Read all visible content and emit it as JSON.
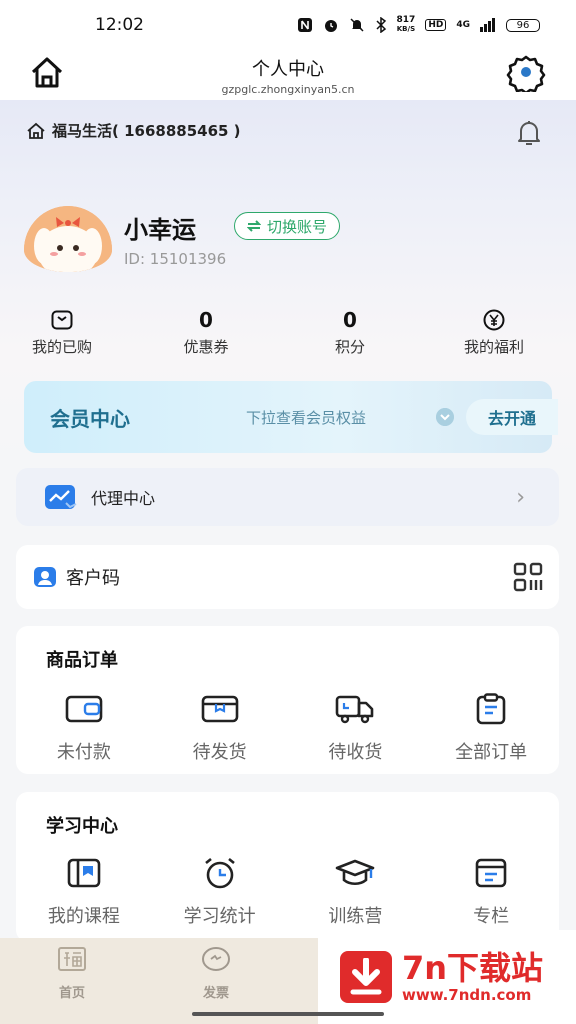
{
  "status_bar": {
    "time": "12:02",
    "net_speed_top": "817",
    "net_speed_bottom": "KB/S",
    "hd": "HD",
    "signal": "4G",
    "battery": "96"
  },
  "header": {
    "title": "个人中心",
    "url": "gzpglc.zhongxinyan5.cn"
  },
  "store": {
    "label": "福马生活( 1668885465 )"
  },
  "profile": {
    "name": "小幸运",
    "switch_label": "切换账号",
    "id": "ID: 15101396"
  },
  "stats": [
    {
      "value": "",
      "label": "我的已购"
    },
    {
      "value": "0",
      "label": "优惠券"
    },
    {
      "value": "0",
      "label": "积分"
    },
    {
      "value": "",
      "label": "我的福利"
    }
  ],
  "vip": {
    "title": "会员中心",
    "tip": "下拉查看会员权益",
    "button": "去开通"
  },
  "agent": {
    "label": "代理中心"
  },
  "customer": {
    "label": "客户码"
  },
  "orders": {
    "title": "商品订单",
    "items": [
      {
        "label": "未付款",
        "icon": "wallet-icon"
      },
      {
        "label": "待发货",
        "icon": "box-icon"
      },
      {
        "label": "待收货",
        "icon": "truck-icon"
      },
      {
        "label": "全部订单",
        "icon": "clipboard-icon"
      }
    ]
  },
  "study": {
    "title": "学习中心",
    "items": [
      {
        "label": "我的课程",
        "icon": "book-icon"
      },
      {
        "label": "学习统计",
        "icon": "alarm-clock-icon"
      },
      {
        "label": "训练营",
        "icon": "graduation-cap-icon"
      },
      {
        "label": "专栏",
        "icon": "column-icon"
      }
    ]
  },
  "tabbar": [
    {
      "label": "首页",
      "icon": "fu-icon"
    },
    {
      "label": "发票",
      "icon": "invoice-icon"
    }
  ],
  "watermark": {
    "big": "7n下载站",
    "small": "www.7ndn.com"
  },
  "colors": {
    "accent_green": "#2ea86b",
    "vip_blue": "#1f6f8f",
    "watermark_red": "#e02b2b"
  }
}
